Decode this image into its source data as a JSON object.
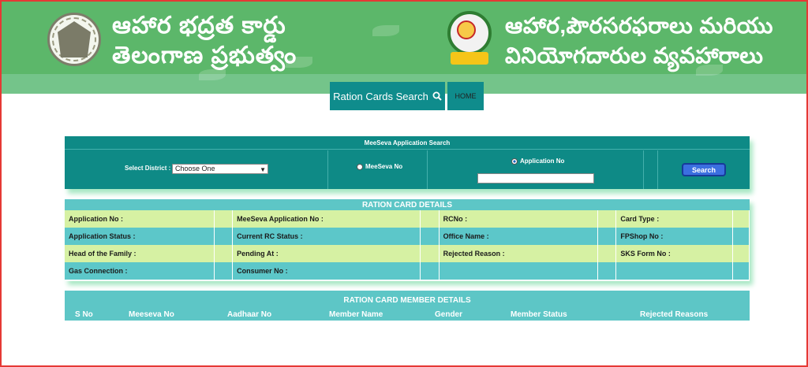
{
  "header": {
    "title_left_line1": "ఆహార భద్రత కార్డు",
    "title_left_line2": "తెలంగాణ ప్రభుత్వం",
    "title_right_line1": "ఆహార,పౌరసరఫరాలు మరియు",
    "title_right_line2": "వినియోగదారుల వ్యవహారాలు",
    "emblem_icon": "telangana-emblem-icon",
    "logo_icon": "civil-supplies-logo-icon"
  },
  "nav": {
    "search_label": "Ration Cards Search",
    "search_icon": "search-icon",
    "home_label": "HOME"
  },
  "search_panel": {
    "title": "MeeSeva Application Search",
    "district_label": "Select District :",
    "district_value": "Choose One",
    "option_meeseva": "MeeSeva No",
    "option_application": "Application No",
    "application_value": "",
    "search_button": "Search"
  },
  "details": {
    "title": "RATION CARD DETAILS",
    "rows": [
      [
        "Application No :",
        "",
        "MeeSeva Application No :",
        "",
        "RCNo :",
        "",
        "Card Type :",
        ""
      ],
      [
        "Application Status :",
        "",
        "Current RC Status :",
        "",
        "Office Name :",
        "",
        "FPShop No :",
        ""
      ],
      [
        "Head of the Family :",
        "",
        "Pending At :",
        "",
        "Rejected Reason :",
        "",
        "SKS Form No :",
        ""
      ],
      [
        "Gas Connection :",
        "",
        "Consumer No :",
        "",
        "",
        "",
        "",
        ""
      ]
    ]
  },
  "members": {
    "title": "RATION CARD MEMBER DETAILS",
    "columns": [
      "S No",
      "Meeseva No",
      "Aadhaar No",
      "Member Name",
      "Gender",
      "Member Status",
      "Rejected Reasons"
    ]
  },
  "colors": {
    "banner": "#5cb76a",
    "teal_dark": "#0e8a86",
    "teal_light": "#5cc7c9",
    "row_light": "#d6f1a3",
    "button_blue": "#3b6fe0",
    "frame_border": "#e53935"
  }
}
